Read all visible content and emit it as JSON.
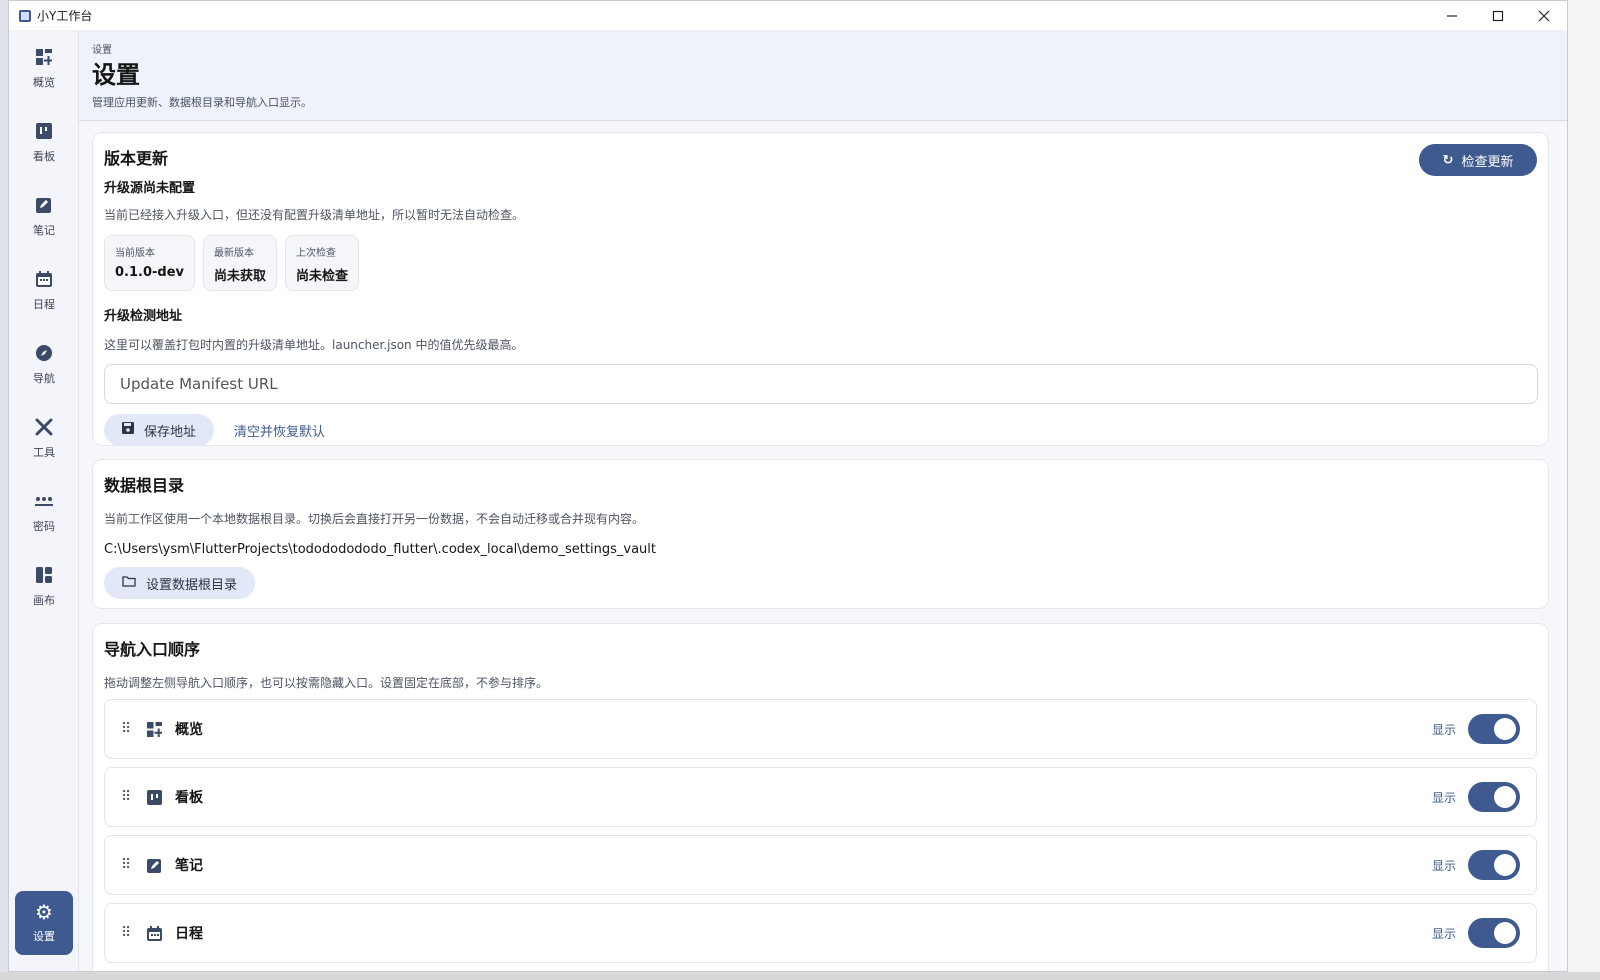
{
  "window": {
    "title": "小Y工作台",
    "minimize": "—",
    "maximize": "☐",
    "close": "✕"
  },
  "sidebar": {
    "items": [
      {
        "label": "概览",
        "icon": "dashboard-icon"
      },
      {
        "label": "看板",
        "icon": "kanban-icon"
      },
      {
        "label": "笔记",
        "icon": "note-icon"
      },
      {
        "label": "日程",
        "icon": "calendar-icon"
      },
      {
        "label": "导航",
        "icon": "compass-icon"
      },
      {
        "label": "工具",
        "icon": "tools-icon"
      },
      {
        "label": "密码",
        "icon": "password-icon"
      },
      {
        "label": "画布",
        "icon": "canvas-icon"
      }
    ],
    "settings": {
      "label": "设置",
      "icon": "gear-icon"
    }
  },
  "header": {
    "breadcrumb": "设置",
    "title": "设置",
    "description": "管理应用更新、数据根目录和导航入口显示。"
  },
  "update": {
    "title": "版本更新",
    "check_button": "检查更新",
    "status_title": "升级源尚未配置",
    "status_desc": "当前已经接入升级入口，但还没有配置升级清单地址，所以暂时无法自动检查。",
    "chips": [
      {
        "label": "当前版本",
        "value": "0.1.0-dev"
      },
      {
        "label": "最新版本",
        "value": "尚未获取"
      },
      {
        "label": "上次检查",
        "value": "尚未检查"
      }
    ],
    "url_title": "升级检测地址",
    "url_desc": "这里可以覆盖打包时内置的升级清单地址。launcher.json 中的值优先级最高。",
    "url_placeholder": "Update Manifest URL",
    "save_button": "保存地址",
    "reset_link": "清空并恢复默认"
  },
  "data_root": {
    "title": "数据根目录",
    "desc": "当前工作区使用一个本地数据根目录。切换后会直接打开另一份数据，不会自动迁移或合并现有内容。",
    "path": "C:\\Users\\ysm\\FlutterProjects\\todododododo_flutter\\.codex_local\\demo_settings_vault",
    "button": "设置数据根目录"
  },
  "nav_order": {
    "title": "导航入口顺序",
    "desc": "拖动调整左侧导航入口顺序，也可以按需隐藏入口。设置固定在底部，不参与排序。",
    "rows": [
      {
        "label": "概览",
        "show": "显示",
        "enabled": true
      },
      {
        "label": "看板",
        "show": "显示",
        "enabled": true
      },
      {
        "label": "笔记",
        "show": "显示",
        "enabled": true
      },
      {
        "label": "日程",
        "show": "显示",
        "enabled": true
      }
    ]
  },
  "colors": {
    "accent": "#3f5a8f",
    "soft_button": "#e3e8f8",
    "header_bg": "#eef2fa"
  }
}
